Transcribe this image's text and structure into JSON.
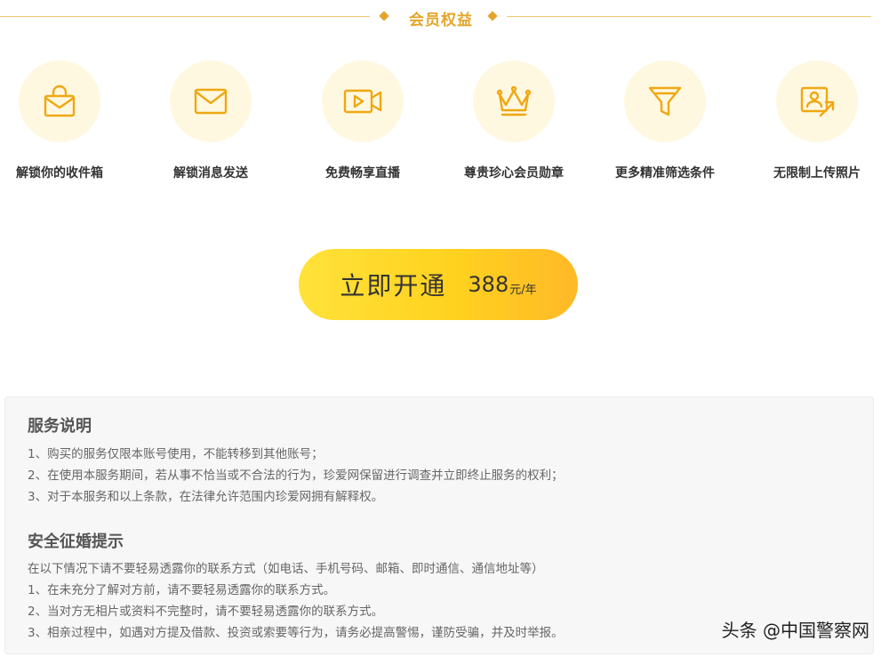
{
  "header": {
    "title": "会员权益"
  },
  "benefits": [
    {
      "label": "解锁你的收件箱",
      "icon": "bag-icon"
    },
    {
      "label": "解锁消息发送",
      "icon": "mail-icon"
    },
    {
      "label": "免费畅享直播",
      "icon": "video-icon"
    },
    {
      "label": "尊贵珍心会员勋章",
      "icon": "crown-icon"
    },
    {
      "label": "更多精准筛选条件",
      "icon": "filter-icon"
    },
    {
      "label": "无限制上传照片",
      "icon": "photo-upload-icon"
    }
  ],
  "cta": {
    "label": "立即开通",
    "price": "388",
    "unit": "元/年"
  },
  "service": {
    "title": "服务说明",
    "lines": [
      "1、购买的服务仅限本账号使用，不能转移到其他账号；",
      "2、在使用本服务期间，若从事不恰当或不合法的行为，珍爱网保留进行调查并立即终止服务的权利；",
      "3、对于本服务和以上条款，在法律允许范围内珍爱网拥有解释权。"
    ]
  },
  "safety": {
    "title": "安全征婚提示",
    "lines": [
      "在以下情况下请不要轻易透露你的联系方式（如电话、手机号码、邮箱、即时通信、通信地址等）",
      "1、在未充分了解对方前，请不要轻易透露你的联系方式。",
      "2、当对方无相片或资料不完整时，请不要轻易透露你的联系方式。",
      "3、相亲过程中，如遇对方提及借款、投资或索要等行为，请务必提高警惕，谨防受骗，并及时举报。"
    ]
  },
  "watermark": "头条 @中国警察网",
  "colors": {
    "accent": "#e3a52a",
    "icon_stroke": "#f0a712",
    "icon_bg": "#fff8e1",
    "button_start": "#ffe23a",
    "button_end": "#ffb928"
  }
}
